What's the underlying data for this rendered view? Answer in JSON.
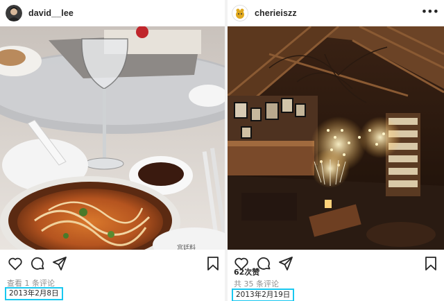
{
  "posts": [
    {
      "username": "david__lee",
      "menu_glyph": "•••",
      "comments_text": "查看 1 条评论",
      "date": "2013年2月8日",
      "photo": "restaurant table with bowl of noodle soup, wine glass and soy sauce dish",
      "icons": [
        "heart-icon",
        "comment-icon",
        "share-icon",
        "bookmark-icon"
      ]
    },
    {
      "username": "cherieiszz",
      "menu_glyph": "•••",
      "likes": "62次赞",
      "comments_text": "共 35 条评论",
      "date": "2013年2月19日",
      "photo": "warmly lit wooden loft interior with bookshelves and string lights",
      "icons": [
        "heart-icon",
        "comment-icon",
        "share-icon",
        "bookmark-icon"
      ]
    }
  ],
  "colors": {
    "text": "#262626",
    "muted": "#8e8e8e",
    "highlight_box": "#19c8f0"
  }
}
